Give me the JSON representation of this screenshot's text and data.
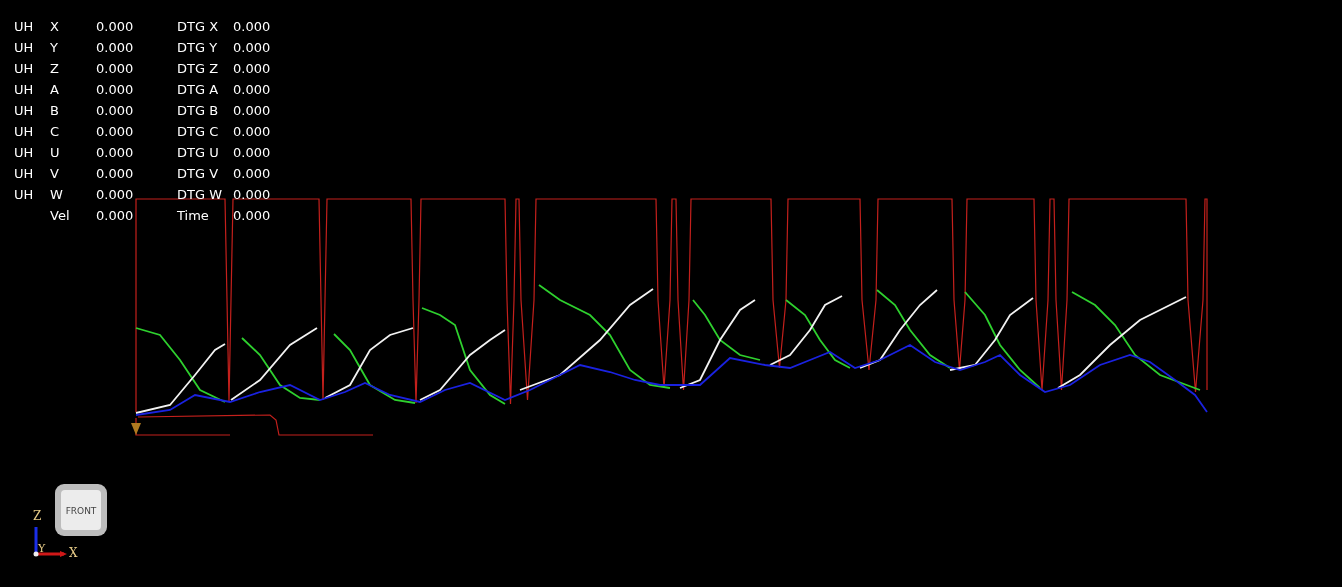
{
  "readout": [
    {
      "unit": "UH",
      "axis": "X",
      "value": "0.000",
      "dtg_label": "DTG X",
      "dtg_value": "0.000"
    },
    {
      "unit": "UH",
      "axis": "Y",
      "value": "0.000",
      "dtg_label": "DTG Y",
      "dtg_value": "0.000"
    },
    {
      "unit": "UH",
      "axis": "Z",
      "value": "0.000",
      "dtg_label": "DTG Z",
      "dtg_value": "0.000"
    },
    {
      "unit": "UH",
      "axis": "A",
      "value": "0.000",
      "dtg_label": "DTG A",
      "dtg_value": "0.000"
    },
    {
      "unit": "UH",
      "axis": "B",
      "value": "0.000",
      "dtg_label": "DTG B",
      "dtg_value": "0.000"
    },
    {
      "unit": "UH",
      "axis": "C",
      "value": "0.000",
      "dtg_label": "DTG C",
      "dtg_value": "0.000"
    },
    {
      "unit": "UH",
      "axis": "U",
      "value": "0.000",
      "dtg_label": "DTG U",
      "dtg_value": "0.000"
    },
    {
      "unit": "UH",
      "axis": "V",
      "value": "0.000",
      "dtg_label": "DTG V",
      "dtg_value": "0.000"
    },
    {
      "unit": "UH",
      "axis": "W",
      "value": "0.000",
      "dtg_label": "DTG W",
      "dtg_value": "0.000"
    },
    {
      "axis": "Vel",
      "value": "0.000",
      "dtg_label": "Time",
      "dtg_value": "0.000"
    }
  ],
  "view_cube": {
    "face": "FRONT"
  },
  "axes_gizmo": {
    "vertical": "Z",
    "depth": "Y",
    "horizontal": "X"
  }
}
